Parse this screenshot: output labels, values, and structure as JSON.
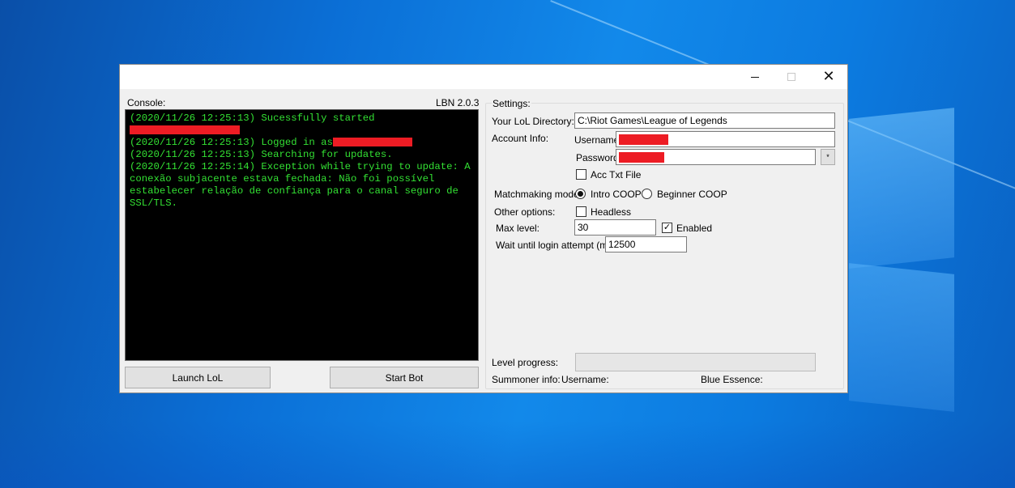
{
  "window": {
    "controls": {
      "minimize": "—",
      "maximize": "☐",
      "close": "✕"
    }
  },
  "console": {
    "label": "Console:",
    "version": "LBN 2.0.3",
    "lines": [
      "(2020/11/26 12:25:13) Sucessfully started ",
      "(2020/11/26 12:25:13) Logged in as",
      "(2020/11/26 12:25:13) Searching for updates.",
      "(2020/11/26 12:25:14) Exception while trying to update: A conexão subjacente estava fechada: Não foi possível estabelecer relação de confiança para o canal seguro de SSL/TLS."
    ],
    "text_color": "#33e033",
    "redaction_color": "#ed1c24"
  },
  "buttons": {
    "launch": "Launch LoL",
    "start": "Start Bot"
  },
  "settings": {
    "group_label": "Settings:",
    "directory": {
      "label": "Your LoL Directory:",
      "value": "C:\\Riot Games\\League of Legends"
    },
    "account": {
      "label": "Account Info:",
      "username_label": "Username",
      "password_label": "Password",
      "reveal_button": "*",
      "acc_txt_label": "Acc Txt File",
      "acc_txt_checked": false
    },
    "matchmaking": {
      "label": "Matchmaking mode:",
      "options": [
        "Intro COOP",
        "Beginner COOP"
      ],
      "selected": "Intro COOP"
    },
    "other": {
      "label": "Other options:",
      "headless_label": "Headless",
      "headless_checked": false,
      "max_level_label": "Max level:",
      "max_level_value": "30",
      "enabled_label": "Enabled",
      "enabled_checked": true,
      "wait_label": "Wait until login attempt (ms):",
      "wait_value": "12500"
    },
    "level_progress": {
      "label": "Level progress:",
      "fraction": 0
    },
    "summoner": {
      "label": "Summoner info:",
      "username_label": "Username:",
      "blue_essence_label": "Blue Essence:"
    }
  }
}
